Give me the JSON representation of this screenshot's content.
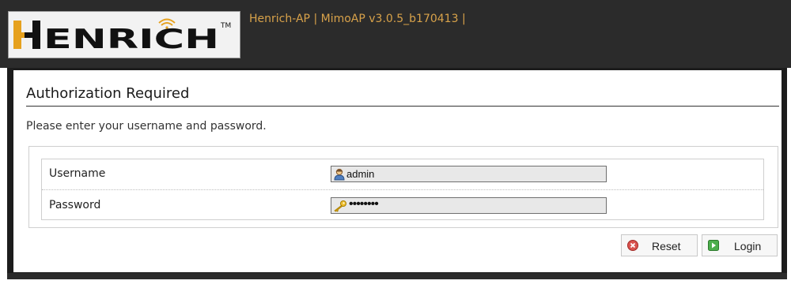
{
  "header": {
    "logo_text": "HENRICH",
    "logo_tm": "TM",
    "info": "Henrich-AP | MimoAP v3.0.5_b170413 |"
  },
  "auth": {
    "title": "Authorization Required",
    "description": "Please enter your username and password.",
    "fields": [
      {
        "label": "Username",
        "value": "admin",
        "icon": "user-icon"
      },
      {
        "label": "Password",
        "value": "••••••••",
        "icon": "key-icon"
      }
    ]
  },
  "buttons": {
    "reset": {
      "label": "Reset",
      "icon": "reset-icon"
    },
    "login": {
      "label": "Login",
      "icon": "login-icon"
    }
  },
  "colors": {
    "header_bg": "#2b2b2b",
    "header_info": "#d8a24a",
    "logo_orange": "#e6a11e"
  }
}
